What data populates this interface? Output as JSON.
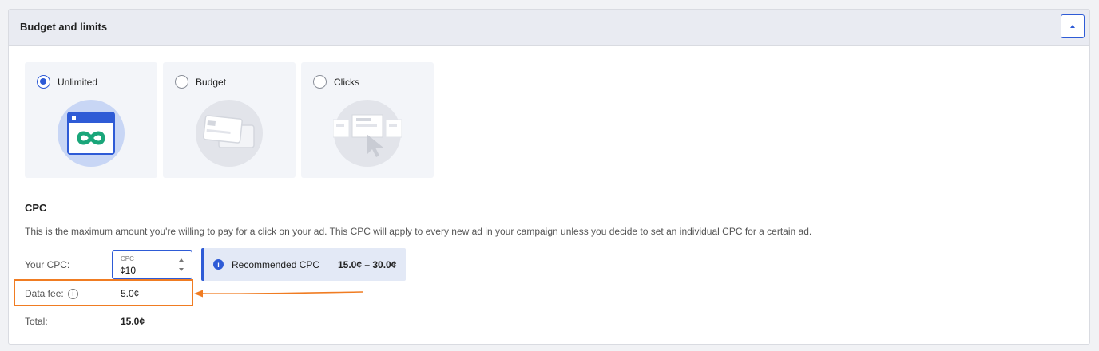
{
  "panel": {
    "title": "Budget and limits"
  },
  "limit_options": [
    {
      "label": "Unlimited",
      "selected": true,
      "icon": "infinity-window-icon"
    },
    {
      "label": "Budget",
      "selected": false,
      "icon": "credit-cards-icon"
    },
    {
      "label": "Clicks",
      "selected": false,
      "icon": "cursor-click-icon"
    }
  ],
  "cpc": {
    "title": "CPC",
    "description": "This is the maximum amount you're willing to pay for a click on your ad. This CPC will apply to every new ad in your campaign unless you decide to set an individual CPC for a certain ad.",
    "your_cpc_label": "Your CPC:",
    "input_caption": "CPC",
    "input_value": "¢10",
    "recommended_label": "Recommended CPC",
    "recommended_range": "15.0¢ – 30.0¢",
    "data_fee_label": "Data fee:",
    "data_fee_value": "5.0¢",
    "total_label": "Total:",
    "total_value": "15.0¢"
  },
  "colors": {
    "accent": "#2e5bd6",
    "highlight": "#f07c22",
    "teal": "#1aa67a"
  }
}
